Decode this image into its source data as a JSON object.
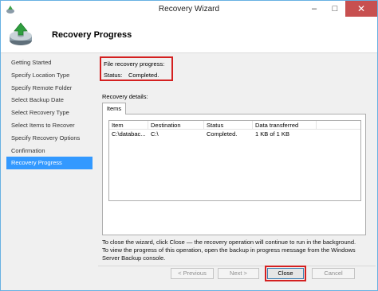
{
  "window": {
    "title": "Recovery Wizard"
  },
  "titlebar": {
    "minimize_glyph": "–",
    "maximize_glyph": "□",
    "close_glyph": "✕"
  },
  "header": {
    "title": "Recovery Progress"
  },
  "steps": [
    {
      "label": "Getting Started"
    },
    {
      "label": "Specify Location Type"
    },
    {
      "label": "Specify Remote Folder"
    },
    {
      "label": "Select Backup Date"
    },
    {
      "label": "Select Recovery Type"
    },
    {
      "label": "Select Items to Recover"
    },
    {
      "label": "Specify Recovery Options"
    },
    {
      "label": "Confirmation"
    },
    {
      "label": "Recovery Progress"
    }
  ],
  "progress": {
    "title": "File recovery progress:",
    "status_label": "Status:",
    "status_value": "Completed."
  },
  "details": {
    "label": "Recovery details:",
    "tab": "Items",
    "columns": [
      "Item",
      "Destination",
      "Status",
      "Data transferred"
    ],
    "rows": [
      {
        "item": "C:\\databac...",
        "destination": "C:\\",
        "status": "Completed.",
        "data": "1 KB of 1 KB"
      }
    ]
  },
  "info": {
    "line1": "To close the wizard, click Close — the recovery operation will continue to run in the background.",
    "line2": "To view the progress of this operation, open the backup in progress message from the Windows",
    "line3": "Server Backup console."
  },
  "buttons": {
    "previous": "< Previous",
    "next": "Next >",
    "close": "Close",
    "cancel": "Cancel"
  }
}
